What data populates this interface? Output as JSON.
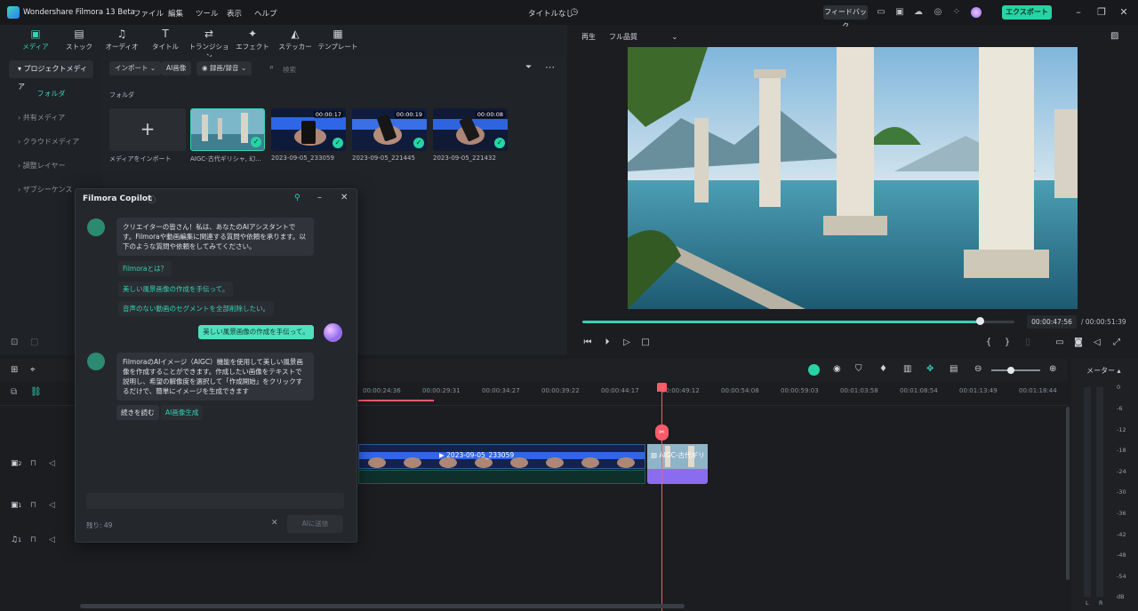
{
  "app": {
    "title": "Wondershare Filmora 13 Beta",
    "menus": [
      "ファイル",
      "編集",
      "ツール",
      "表示",
      "ヘルプ"
    ],
    "doc_title": "タイトルなし",
    "feedback": "フィードバック",
    "export": "エクスポート"
  },
  "media_tools": [
    {
      "label": "メディア",
      "icon": "▣"
    },
    {
      "label": "ストック",
      "icon": "▤"
    },
    {
      "label": "オーディオ",
      "icon": "♫"
    },
    {
      "label": "タイトル",
      "icon": "T"
    },
    {
      "label": "トランジション",
      "icon": "⇄"
    },
    {
      "label": "エフェクト",
      "icon": "✦"
    },
    {
      "label": "ステッカー",
      "icon": "◭"
    },
    {
      "label": "テンプレート",
      "icon": "▦"
    }
  ],
  "left_panel": {
    "project_media": "プロジェクトメディア",
    "folder": "フォルダ",
    "items": [
      "共有メディア",
      "クラウドメディア",
      "調整レイヤー",
      "ザブシーケンス"
    ]
  },
  "media_bar": {
    "import": "インポート",
    "ai_image": "AI画像",
    "record": "録画/録音",
    "search_placeholder": "検索",
    "folder_label": "フォルダ"
  },
  "media_items": [
    {
      "name": "メディアをインポート"
    },
    {
      "name": "AIGC-古代ギリシャ, 幻...",
      "duration": ""
    },
    {
      "name": "2023-09-05_233059",
      "duration": "00:00:17"
    },
    {
      "name": "2023-09-05_221445",
      "duration": "00:00:19"
    },
    {
      "name": "2023-09-05_221432",
      "duration": "00:00:08"
    }
  ],
  "player": {
    "label": "再生",
    "quality": "フル品質",
    "current_time": "00:00:47:56",
    "total_time": "/ 00:00:51:39",
    "progress": 0.92
  },
  "copilot": {
    "title": "Filmora Copilot",
    "greeting": "クリエイターの皆さん！私は、あなたのAIアシスタントです。Filmoraや動画編集に関連する質問や依頼を承ります。以下のような質問や依頼をしてみてください。",
    "suggestions": [
      "Filmoraとは？",
      "美しい風景画像の作成を手伝って。",
      "音声のない動画のセグメントを全部削除したい。"
    ],
    "user_message": "美しい風景画像の作成を手伝って。",
    "answer": "FilmoraのAIイメージ（AIGC）機能を使用して美しい風景画像を作成することができます。作成したい画像をテキストで説明し、希望の解像度を選択して「作成開始」をクリックするだけで、簡単にイメージを生成できます",
    "actions": [
      "続きを読む",
      "AI画像生成"
    ],
    "remaining": "残り: 49",
    "send": "AIに送信"
  },
  "timeline": {
    "ticks": [
      "00:00:24:36",
      "00:00:29:31",
      "00:00:34:27",
      "00:00:39:22",
      "00:00:44:17",
      "00:00:49:12",
      "00:00:54:08",
      "00:00:59:03",
      "00:01:03:58",
      "00:01:08:54",
      "00:01:13:49",
      "00:01:18:44"
    ],
    "clip_name": "2023-09-05_233059",
    "img_clip_name": "AIGC-古代ギリ",
    "track_labels": [
      "2",
      "1",
      "1"
    ]
  },
  "meter": {
    "title": "メーター",
    "db": [
      "0",
      "-6",
      "-12",
      "-18",
      "-24",
      "-30",
      "-36",
      "-42",
      "-48",
      "-54",
      "dB"
    ],
    "channels": [
      "L",
      "R"
    ]
  },
  "colors": {
    "accent": "#35d2b4",
    "playhead": "#ff5a6a",
    "export": "#26d4a4"
  }
}
